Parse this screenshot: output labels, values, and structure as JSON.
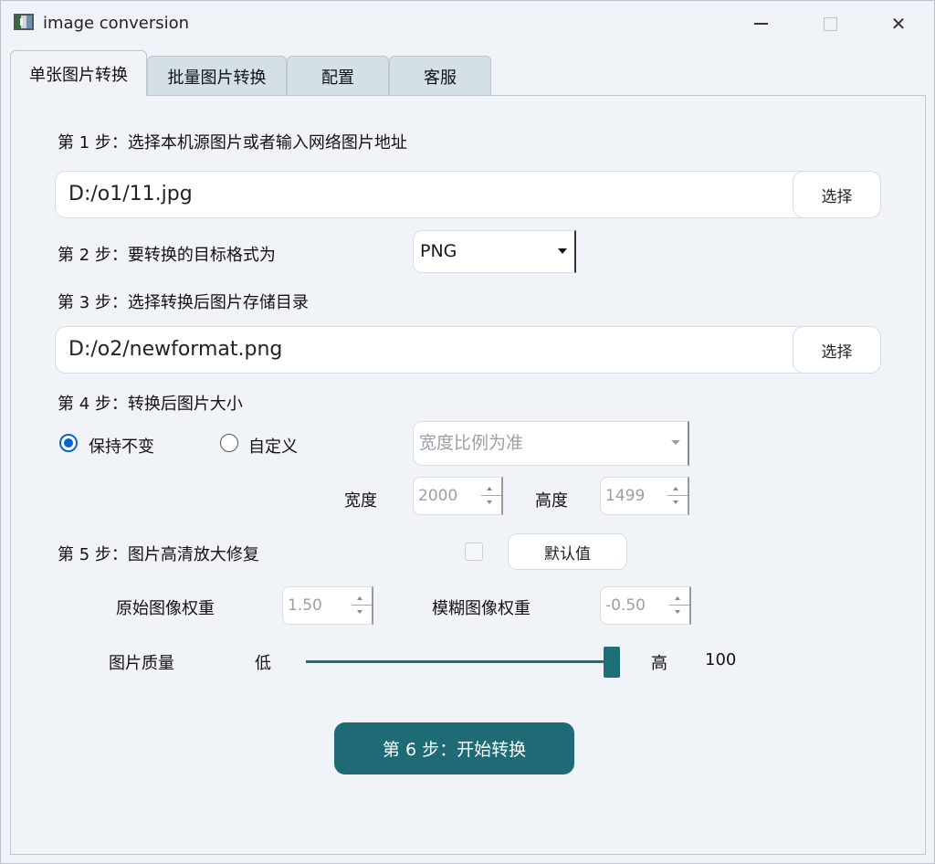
{
  "window": {
    "title": "image conversion",
    "icons": {
      "app": "image-app-icon",
      "minimize": "minimize-icon",
      "maximize": "maximize-icon",
      "close": "close-icon"
    },
    "close_glyph": "✕"
  },
  "tabs": [
    {
      "label": "单张图片转换",
      "active": true
    },
    {
      "label": "批量图片转换",
      "active": false
    },
    {
      "label": "配置",
      "active": false
    },
    {
      "label": "客服",
      "active": false
    }
  ],
  "step1": {
    "label": "第 1 步：选择本机源图片或者输入网络图片地址",
    "path_value": "D:/o1/11.jpg",
    "pick_label": "选择"
  },
  "step2": {
    "label": "第 2 步：要转换的目标格式为",
    "format_value": "PNG"
  },
  "step3": {
    "label": "第 3 步：选择转换后图片存储目录",
    "path_value": "D:/o2/newformat.png",
    "pick_label": "选择"
  },
  "step4": {
    "label": "第 4 步：转换后图片大小",
    "radio_keep": "保持不变",
    "radio_custom": "自定义",
    "selected": "keep",
    "ratio_mode": "宽度比例为准",
    "width_label": "宽度",
    "width_value": "2000",
    "height_label": "高度",
    "height_value": "1499"
  },
  "step5": {
    "label": "第 5 步：图片高清放大修复",
    "enabled": false,
    "default_label": "默认值",
    "orig_weight_label": "原始图像权重",
    "orig_weight_value": "1.50",
    "blur_weight_label": "模糊图像权重",
    "blur_weight_value": "-0.50"
  },
  "quality": {
    "label": "图片质量",
    "low_label": "低",
    "high_label": "高",
    "value_text": "100",
    "value": 100,
    "max": 100
  },
  "start_button": "第 6 步：开始转换",
  "colors": {
    "accent": "#1f6b75",
    "radio": "#0a63c8"
  }
}
